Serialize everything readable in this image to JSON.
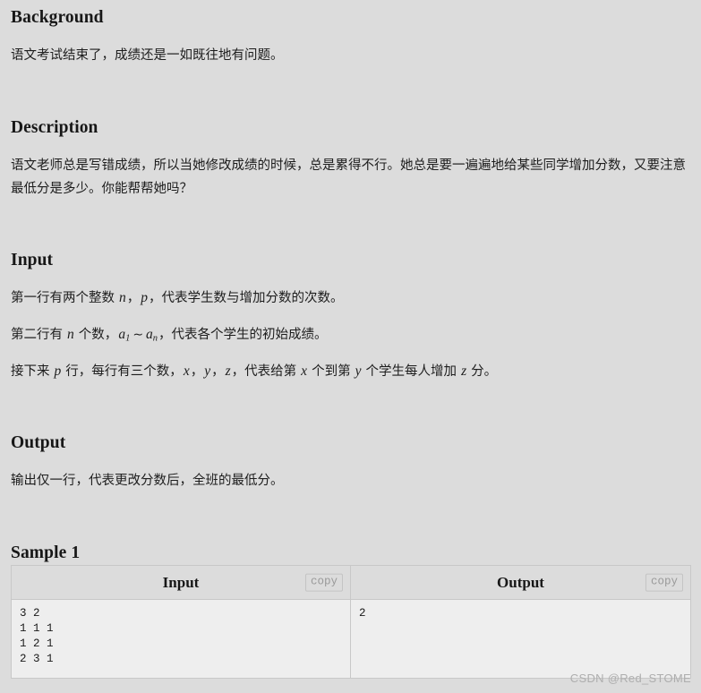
{
  "sections": {
    "background": {
      "title": "Background",
      "text": "语文考试结束了，成绩还是一如既往地有问题。"
    },
    "description": {
      "title": "Description",
      "text": "语文老师总是写错成绩，所以当她修改成绩的时候，总是累得不行。她总是要一遍遍地给某些同学增加分数，又要注意最低分是多少。你能帮帮她吗？"
    },
    "input": {
      "title": "Input",
      "line1": {
        "before": "第一行有两个整数 ",
        "var1": "n",
        "mid": "，",
        "var2": "p",
        "after": "，代表学生数与增加分数的次数。"
      },
      "line2": {
        "before": "第二行有 ",
        "var1": "n",
        "mid1": " 个数，",
        "var2": "a",
        "sub2": "1",
        "tilde": "∼",
        "var3": "a",
        "sub3": "n",
        "after": "，代表各个学生的初始成绩。"
      },
      "line3": {
        "before": "接下来 ",
        "var1": "p",
        "mid1": " 行，每行有三个数，",
        "var2": "x",
        "comma1": "，",
        "var3": "y",
        "comma2": "，",
        "var4": "z",
        "mid2": "，代表给第 ",
        "var5": "x",
        "mid3": " 个到第 ",
        "var6": "y",
        "mid4": " 个学生每人增加 ",
        "var7": "z",
        "after": " 分。"
      }
    },
    "output": {
      "title": "Output",
      "text": "输出仅一行，代表更改分数后，全班的最低分。"
    },
    "sample": {
      "title": "Sample 1",
      "columns": [
        {
          "header": "Input",
          "copy_label": "copy"
        },
        {
          "header": "Output",
          "copy_label": "copy"
        }
      ],
      "input_text": "3 2\n1 1 1\n1 2 1\n2 3 1",
      "output_text": "2"
    }
  },
  "watermark": "CSDN @Red_STOME",
  "colors": {
    "page_background": "#dcdcdc",
    "table_body_background": "#eeeeee",
    "table_border": "#c8c8c8",
    "text": "#1d1d1d",
    "watermark": "#aeaeae"
  }
}
